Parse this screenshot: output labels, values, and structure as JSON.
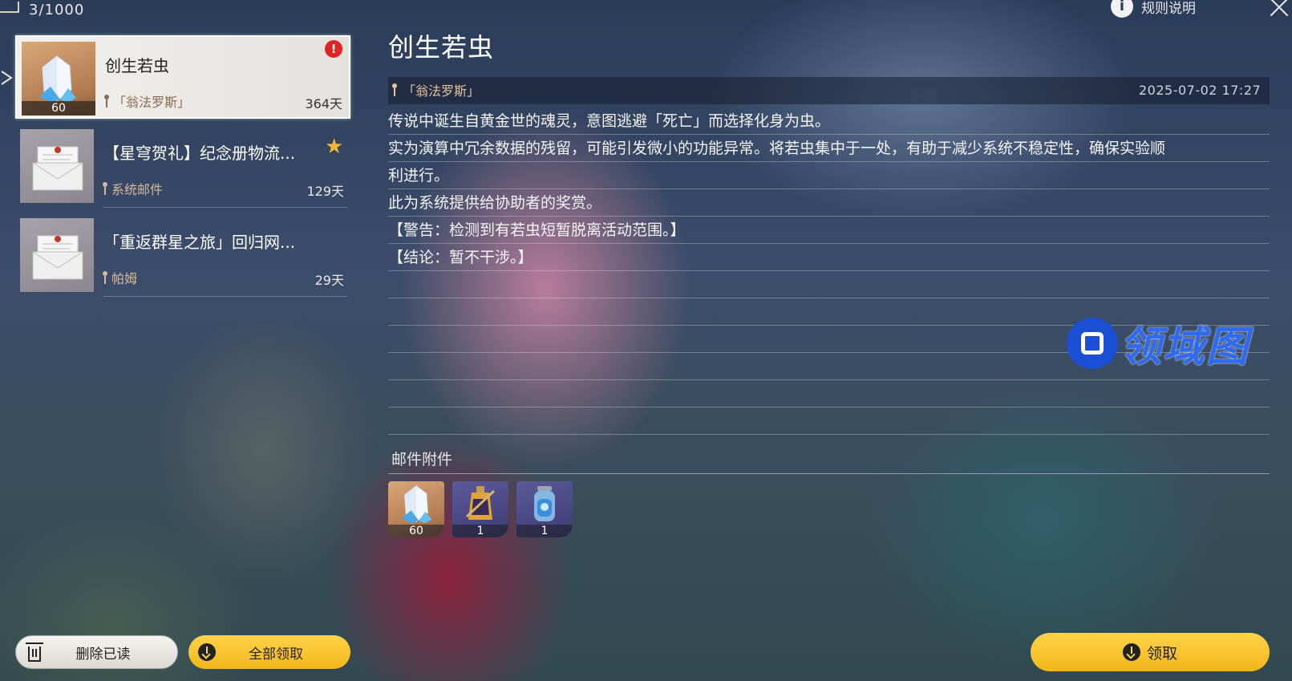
{
  "topbar": {
    "mail_count": "3/1000",
    "rules_label": "规则说明"
  },
  "mail_list": [
    {
      "title": "创生若虫",
      "sender": "「翁法罗斯」",
      "days": "364天",
      "qty": "60",
      "badge": "alert"
    },
    {
      "title": "【星穹贺礼】纪念册物流...",
      "sender": "系统邮件",
      "days": "129天",
      "badge": "star"
    },
    {
      "title": "「重返群星之旅」回归网...",
      "sender": "帕姆",
      "days": "29天"
    }
  ],
  "detail": {
    "title": "创生若虫",
    "sender": "「翁法罗斯」",
    "date": "2025-07-02 17:27",
    "lines": [
      "传说中诞生自黄金世的魂灵，意图逃避「死亡」而选择化身为虫。",
      "实为演算中冗余数据的残留，可能引发微小的功能异常。将若虫集中于一处，有助于减少系统不稳定性，确保实验顺",
      "利进行。",
      "此为系统提供给协助者的奖赏。",
      "【警告：检测到有若虫短暂脱离活动范围。】",
      "【结论：暂不干涉。】"
    ]
  },
  "attachments": {
    "label": "邮件附件",
    "items": [
      {
        "name": "crystal",
        "qty": "60"
      },
      {
        "name": "potion",
        "qty": "1"
      },
      {
        "name": "jar",
        "qty": "1"
      }
    ]
  },
  "buttons": {
    "delete_read": "删除已读",
    "claim_all": "全部领取",
    "claim": "领取"
  },
  "watermark": "领域图",
  "colors": {
    "accent_yellow": "#f3b619",
    "alert_red": "#e02424",
    "star_gold": "#f1b53c"
  }
}
